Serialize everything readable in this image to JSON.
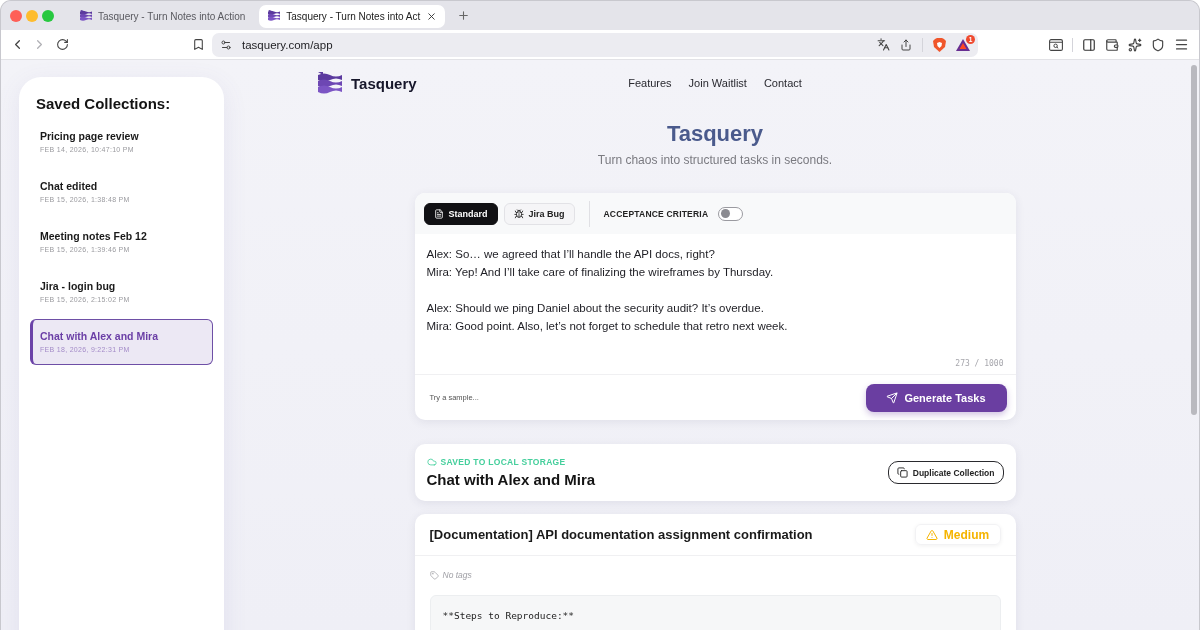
{
  "browser": {
    "tabs": [
      {
        "title": "Tasquery - Turn Notes into Action",
        "selected": false
      },
      {
        "title": "Tasquery - Turn Notes into Act",
        "selected": true
      }
    ],
    "address": "tasquery.com/app",
    "rewards_badge": "1"
  },
  "sidebar": {
    "title": "Saved Collections:",
    "items": [
      {
        "title": "Pricing page review",
        "date": "FEB 14, 2026, 10:47:10 PM",
        "selected": false
      },
      {
        "title": "Chat edited",
        "date": "FEB 15, 2026, 1:38:48 PM",
        "selected": false
      },
      {
        "title": "Meeting notes Feb 12",
        "date": "FEB 15, 2026, 1:39:46 PM",
        "selected": false
      },
      {
        "title": "Jira - login bug",
        "date": "FEB 15, 2026, 2:15:02 PM",
        "selected": false
      },
      {
        "title": "Chat with Alex and Mira",
        "date": "FEB 18, 2026, 9:22:31 PM",
        "selected": true
      }
    ]
  },
  "header": {
    "brand": "Tasquery",
    "nav": [
      "Features",
      "Join Waitlist",
      "Contact"
    ]
  },
  "hero": {
    "title": "Tasquery",
    "subtitle": "Turn chaos into structured tasks in seconds."
  },
  "composer": {
    "modes": [
      {
        "label": "Standard",
        "kind": "document",
        "selected": true
      },
      {
        "label": "Jira Bug",
        "kind": "bug",
        "selected": false
      }
    ],
    "toggle": {
      "label": "ACCEPTANCE CRITERIA",
      "on": false
    },
    "value": "Alex: So… we agreed that I’ll handle the API docs, right?\nMira: Yep! And I’ll take care of finalizing the wireframes by Thursday.\n\nAlex: Should we ping Daniel about the security audit? It’s overdue.\nMira: Good point. Also, let’s not forget to schedule that retro next week.",
    "counter": "273 / 1000",
    "sample_link": "Try a sample...",
    "submit": "Generate Tasks"
  },
  "collection": {
    "status": "SAVED TO LOCAL STORAGE",
    "title": "Chat with Alex and Mira",
    "action": "Duplicate Collection"
  },
  "task": {
    "title": "[Documentation] API documentation assignment confirmation",
    "priority": {
      "label": "Medium",
      "kind": "medium"
    },
    "tags": "No tags",
    "body": "**Steps to Reproduce:**"
  }
}
